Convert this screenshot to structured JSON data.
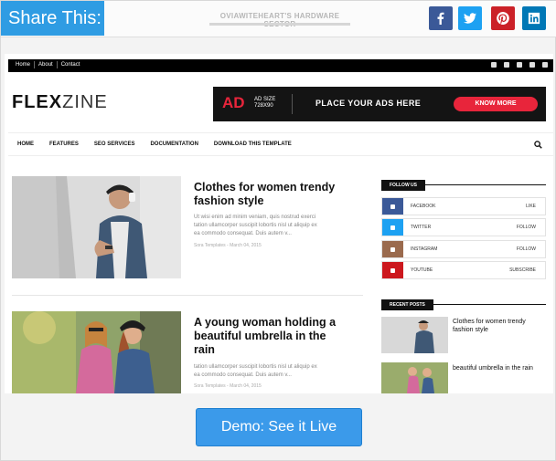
{
  "share": {
    "label": "Share This:",
    "watermark": "OVIAWITEHEART'S HARDWARE SECTOR",
    "buttons": [
      {
        "name": "facebook",
        "icon": "facebook-icon",
        "color": "#3b5998"
      },
      {
        "name": "twitter",
        "icon": "twitter-icon",
        "color": "#1da1f2"
      },
      {
        "name": "pinterest",
        "icon": "pinterest-icon",
        "color": "#cb2027"
      },
      {
        "name": "linkedin",
        "icon": "linkedin-icon",
        "color": "#0077b5"
      }
    ]
  },
  "site": {
    "topnav": [
      "Home",
      "About",
      "Contact"
    ],
    "logo_bold": "FLEX",
    "logo_thin": "ZINE",
    "ad": {
      "big": "AD",
      "size_line1": "AD SIZE",
      "size_line2": "728X90",
      "text": "PLACE YOUR ADS HERE",
      "button": "KNOW MORE"
    },
    "mainnav": [
      "HOME",
      "FEATURES",
      "SEO SERVICES",
      "DOCUMENTATION",
      "DOWNLOAD THIS TEMPLATE"
    ]
  },
  "posts": [
    {
      "title_line1": "Clothes for women trendy",
      "title_line2": "fashion style",
      "excerpt_line1": "Ut wisi enim ad minim veniam, quis nostrud exerci",
      "excerpt_line2": "tation ullamcorper suscipit lobortis nisl ut aliquip ex",
      "excerpt_line3": "ea commodo consequat. Duis autem v...",
      "meta": "Sora Templates - March 04, 2015"
    },
    {
      "title_line1": "A young woman holding a",
      "title_line2": "beautiful umbrella in the",
      "title_line3": "rain",
      "excerpt_line1": "tation ullamcorper suscipit lobortis nisl ut aliquip ex",
      "excerpt_line2": "ea commodo consequat. Duis autem v...",
      "meta": "Sora Templates - March 04, 2015"
    }
  ],
  "sidebar": {
    "follow_title": "FOLLOW US",
    "follow": [
      {
        "name": "FACEBOOK",
        "action": "LIKE",
        "color": "#3b5998"
      },
      {
        "name": "TWITTER",
        "action": "FOLLOW",
        "color": "#1da1f2"
      },
      {
        "name": "INSTAGRAM",
        "action": "FOLLOW",
        "color": "#9a6a4d"
      },
      {
        "name": "YOUTUBE",
        "action": "SUBSCRIBE",
        "color": "#cc181e"
      }
    ],
    "recent_title": "RECENT POSTS",
    "recent": [
      {
        "line1": "Clothes for women trendy",
        "line2": "fashion style"
      },
      {
        "line1": "beautiful umbrella in the rain"
      }
    ]
  },
  "demo_button": "Demo: See it Live"
}
